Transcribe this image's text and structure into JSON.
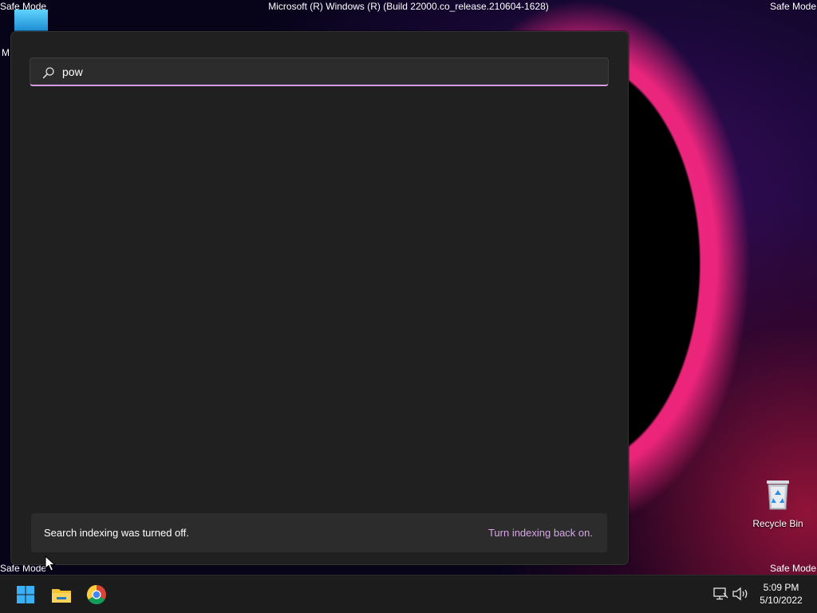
{
  "desktop": {
    "safe_mode_label": "Safe Mode",
    "build_text": "Microsoft (R) Windows (R) (Build 22000.co_release.210604-1628)",
    "partial_icon_letter": "M",
    "recycle_bin_label": "Recycle Bin"
  },
  "search": {
    "query": "pow",
    "index_message": "Search indexing was turned off.",
    "index_link": "Turn indexing back on."
  },
  "taskbar": {
    "pinned": [
      "windows-start-icon",
      "file-explorer-icon",
      "chrome-icon"
    ],
    "time": "5:09 PM",
    "date": "5/10/2022"
  },
  "colors": {
    "accent": "#d79ae7",
    "panel_bg": "#202020",
    "taskbar_bg": "#1c1c1c"
  }
}
